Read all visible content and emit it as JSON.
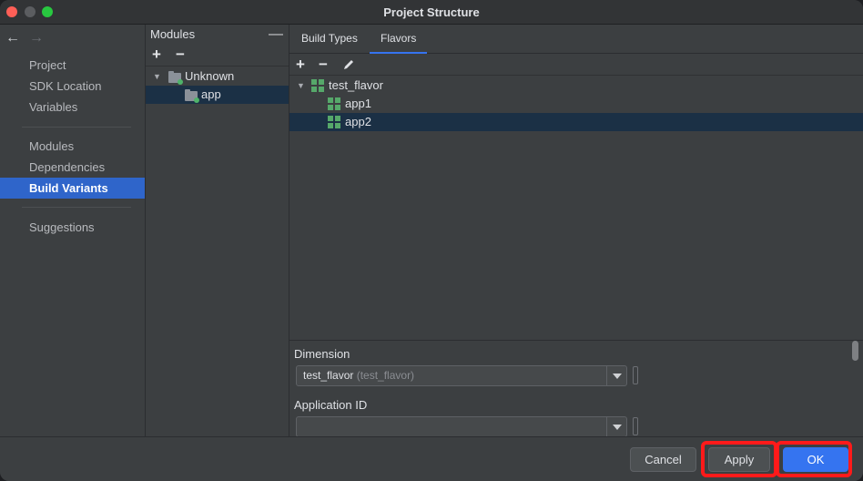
{
  "window": {
    "title": "Project Structure"
  },
  "nav": {
    "back_icon": "arrow-left-icon",
    "forward_icon": "arrow-right-icon",
    "group1": [
      "Project",
      "SDK Location",
      "Variables"
    ],
    "group2": [
      "Modules",
      "Dependencies",
      "Build Variants"
    ],
    "group3": [
      "Suggestions"
    ],
    "selected": "Build Variants"
  },
  "modules": {
    "header": "Modules",
    "collapse_symbol": "—",
    "add_symbol": "+",
    "remove_symbol": "−",
    "tree": [
      {
        "label": "Unknown",
        "expanded": true
      },
      {
        "label": "app",
        "selected": true
      }
    ]
  },
  "tabs": [
    {
      "label": "Build Types",
      "active": false
    },
    {
      "label": "Flavors",
      "active": true
    }
  ],
  "flavors": {
    "add_symbol": "+",
    "remove_symbol": "−",
    "edit_icon": "pencil-icon",
    "tree": [
      {
        "label": "test_flavor",
        "expanded": true
      },
      {
        "label": "app1"
      },
      {
        "label": "app2",
        "selected": true
      }
    ]
  },
  "properties": {
    "dimension_label": "Dimension",
    "dimension_value": "test_flavor",
    "dimension_hint": "(test_flavor)",
    "application_id_label": "Application ID",
    "application_id_value": ""
  },
  "buttons": {
    "cancel": "Cancel",
    "apply": "Apply",
    "ok": "OK"
  },
  "colors": {
    "accent": "#3574f0",
    "selection": "#2f65ca",
    "highlight": "#ff1a1a"
  }
}
